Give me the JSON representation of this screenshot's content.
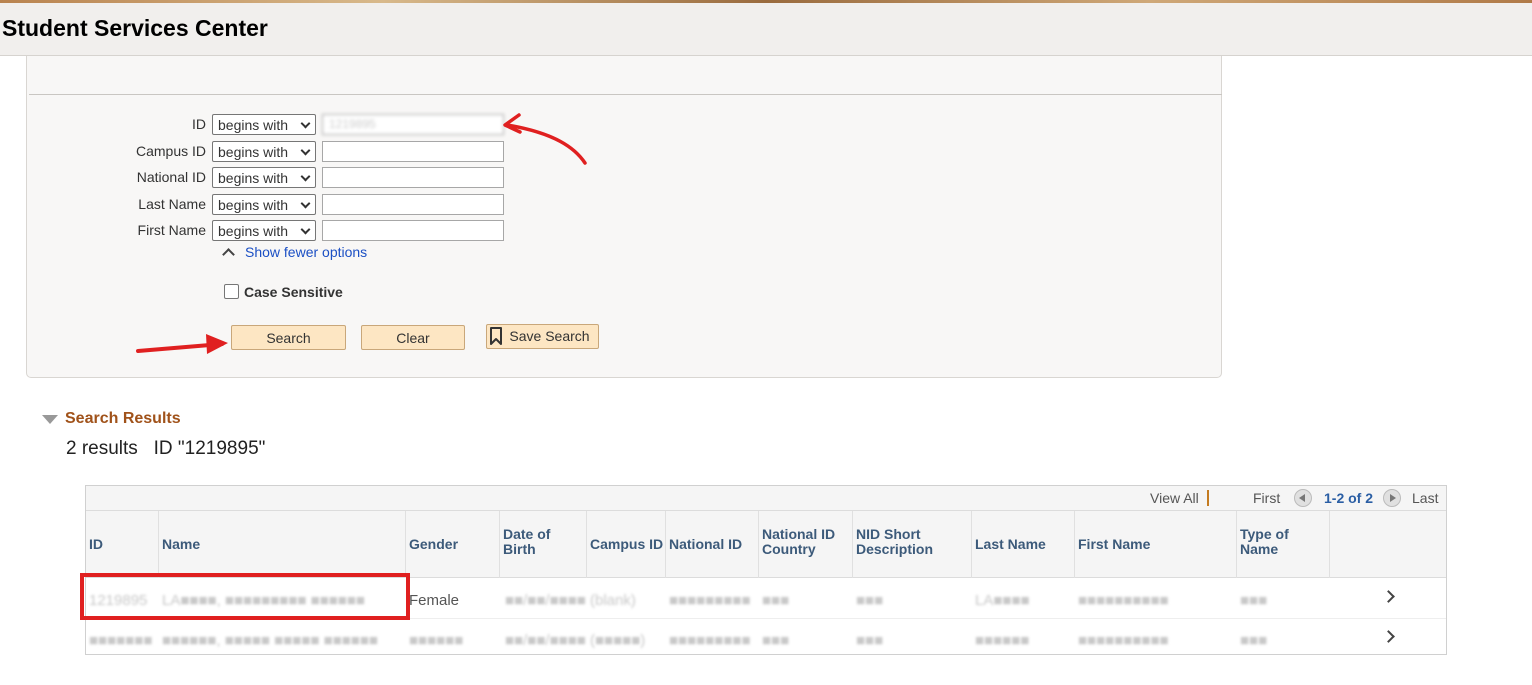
{
  "header": {
    "title": "Student Services Center"
  },
  "search_form": {
    "fields": [
      {
        "label": "ID",
        "operator": "begins with",
        "value": "1219895"
      },
      {
        "label": "Campus ID",
        "operator": "begins with",
        "value": ""
      },
      {
        "label": "National ID",
        "operator": "begins with",
        "value": ""
      },
      {
        "label": "Last Name",
        "operator": "begins with",
        "value": ""
      },
      {
        "label": "First Name",
        "operator": "begins with",
        "value": ""
      }
    ],
    "show_fewer_label": "Show fewer options",
    "case_sensitive_label": "Case Sensitive",
    "case_sensitive_checked": false,
    "buttons": {
      "search": "Search",
      "clear": "Clear",
      "save_search": "Save Search"
    }
  },
  "results": {
    "section_title": "Search Results",
    "summary": "2 results   ID \"1219895\"",
    "pager": {
      "view_all": "View All",
      "first": "First",
      "range": "1-2 of 2",
      "last": "Last"
    },
    "columns": [
      "ID",
      "Name",
      "Gender",
      "Date of Birth",
      "Campus ID",
      "National ID",
      "National ID Country",
      "NID Short Description",
      "Last Name",
      "First Name",
      "Type of Name"
    ],
    "rows": [
      {
        "id": "1219895",
        "name": "LA■■■■, ■■■■■■■■■ ■■■■■■",
        "gender": "Female",
        "dob": "■■/■■/■■■■",
        "campus_id": "(blank)",
        "national_id": "■■■■■■■■■",
        "nid_country": "■■■",
        "nid_short": "■■■",
        "last_name": "LA■■■■",
        "first_name": "■■■■■■■■■■",
        "type_of_name": "■■■"
      },
      {
        "id": "■■■■■■■",
        "name": "■■■■■■, ■■■■■ ■■■■■ ■■■■■■",
        "gender": "■■■■■■",
        "dob": "■■/■■/■■■■",
        "campus_id": "(■■■■■)",
        "national_id": "■■■■■■■■■",
        "nid_country": "■■■",
        "nid_short": "■■■",
        "last_name": "■■■■■■",
        "first_name": "■■■■■■■■■■",
        "type_of_name": "■■■"
      }
    ]
  },
  "colors": {
    "annotation_red": "#e02020",
    "link_blue": "#1b4fc4",
    "section_title": "#a0521a",
    "button_bg": "#fde6c3"
  }
}
